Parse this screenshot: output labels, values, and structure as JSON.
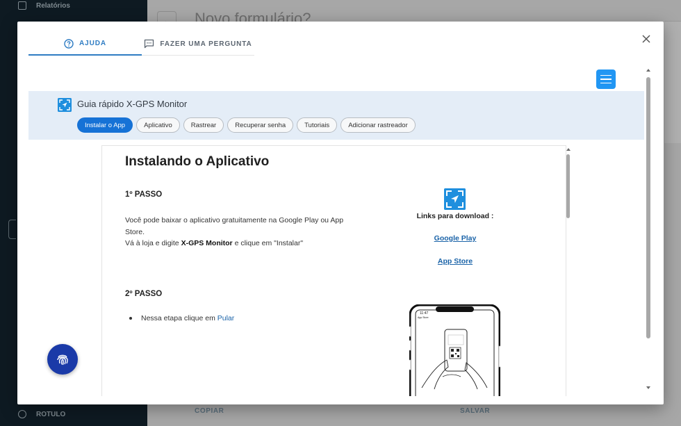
{
  "background": {
    "sidebar": {
      "top_item": "Relatórios",
      "bottom_item": "ROTULO"
    },
    "page_title": "Novo formulário?",
    "footer": {
      "copy_label": "COPIAR",
      "save_label": "SALVAR"
    }
  },
  "modal": {
    "tabs": [
      {
        "label": "AJUDA",
        "icon": "help-circle-icon",
        "active": true
      },
      {
        "label": "FAZER UMA PERGUNTA",
        "icon": "chat-icon",
        "active": false
      }
    ],
    "guide": {
      "title": "Guia rápido X-GPS Monitor",
      "pills": [
        {
          "label": "Instalar o App",
          "active": true
        },
        {
          "label": "Aplicativo",
          "active": false
        },
        {
          "label": "Rastrear",
          "active": false
        },
        {
          "label": "Recuperar senha",
          "active": false
        },
        {
          "label": "Tutoriais",
          "active": false
        },
        {
          "label": "Adicionar rastreador",
          "active": false
        }
      ]
    },
    "content": {
      "title": "Instalando o Aplicativo",
      "step1": {
        "heading": "1º PASSO",
        "line1": "Você pode baixar o aplicativo gratuitamente na Google Play ou App Store.",
        "line2_prefix": "Vá à loja e digite ",
        "line2_bold": "X-GPS Monitor",
        "line2_suffix": " e clique em \"Instalar\""
      },
      "step2": {
        "heading": "2º PASSO",
        "bullet_prefix": "Nessa etapa clique em ",
        "bullet_link": "Pular"
      },
      "downloads": {
        "label": "Links para download :",
        "google_play": "Google Play",
        "app_store": "App Store"
      },
      "phone_status_time": "11:47",
      "phone_status_app": "App Store"
    },
    "colors": {
      "accent": "#2e7cc3",
      "pill_active": "#1672d6",
      "logo_blue": "#1f8fde",
      "header_bg": "#e4edf7",
      "fab": "#1a3aa8"
    }
  }
}
